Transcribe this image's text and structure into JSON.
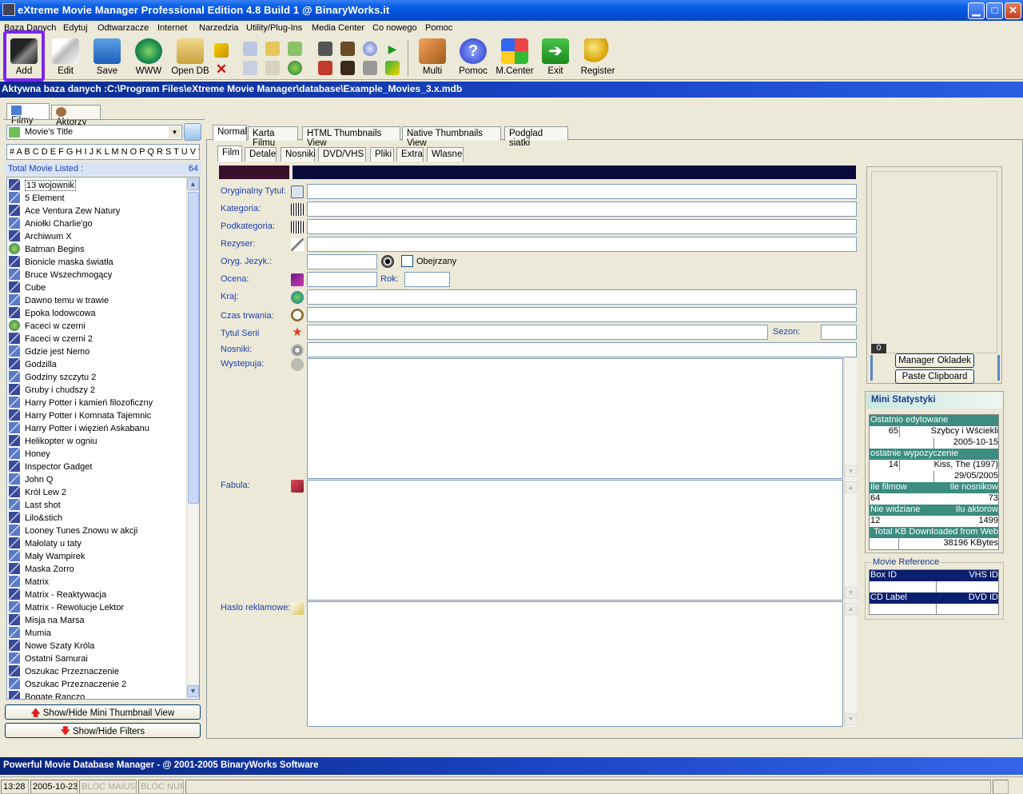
{
  "window": {
    "title": "eXtreme Movie Manager Professional Edition 4.8 Build 1 @ BinaryWorks.it",
    "min": "▁",
    "max": "□",
    "close": "✕"
  },
  "menu": [
    "Baza Danych",
    "Edytuj",
    "Odtwarzacze",
    "Internet",
    "Narzedzia",
    "Utility/Plug-Ins",
    "Media Center",
    "Co nowego",
    "Pomoc"
  ],
  "toolbar": {
    "add": "Add",
    "edit": "Edit",
    "save": "Save",
    "www": "WWW",
    "opendb": "Open DB",
    "multi": "Multi",
    "pomoc": "Pomoc",
    "mcenter": "M.Center",
    "exit": "Exit",
    "register": "Register"
  },
  "db_path": "Aktywna baza danych :C:\\Program Files\\eXtreme Movie Manager\\database\\Example_Movies_3.x.mdb",
  "left_tabs": {
    "filmy": "Filmy",
    "aktorzy": "Aktorzy"
  },
  "sort_field": "Movie's Title",
  "alphabet": "# A B C D E F G H I J K L M N O P Q R S T U V W X Y Z",
  "total_label": "Total Movie Listed :",
  "total_count": "64",
  "movies": [
    "13 wojownik",
    "5 Element",
    "Ace Ventura Zew Natury",
    "Aniołki Charlie'go",
    "Archiwum X",
    "Batman Begins",
    "Bionicle maska światła",
    "Bruce Wszechmogący",
    "Cube",
    "Dawno temu w trawie",
    "Epoka lodowcowa",
    "Faceci w czerni",
    "Faceci w czerni 2",
    "Gdzie jest Nemo",
    "Godzilla",
    "Godziny szczytu 2",
    "Gruby i chudszy 2",
    "Harry Potter i kamień filozoficzny",
    "Harry Potter i Komnata Tajemnic",
    "Harry Potter i więzień Askabanu",
    "Helikopter w ogniu",
    "Honey",
    "Inspector Gadget",
    "John Q",
    "Król Lew 2",
    "Last shot",
    "Lilo&stich",
    "Looney Tunes Znowu w akcji",
    "Małolaty u taty",
    "Mały Wampirek",
    "Maska Zorro",
    "Matrix",
    "Matrix - Reaktywacja",
    "Matrix - Rewolucje   Lektor",
    "Misja na Marsa",
    "Mumia",
    "Nowe Szaty Króla",
    "Ostatni Samurai",
    "Oszukac Przeznaczenie",
    "Oszukac Przeznaczenie 2",
    "Bogate Ranczo"
  ],
  "buttons": {
    "thumb": "Show/Hide Mini Thumbnail View",
    "filters": "Show/Hide Filters",
    "manager": "Manager Okladek",
    "paste": "Paste Clipboard"
  },
  "view_tabs": [
    "Normal",
    "Karta Filmu",
    "HTML Thumbnails View",
    "Native Thumbnails View",
    "Podglad siatki"
  ],
  "sub_tabs": [
    "Film",
    "Detale",
    "Nosniki",
    "DVD/VHS",
    "Pliki",
    "Extra",
    "Wlasne"
  ],
  "fields": {
    "orig_title": "Oryginalny Tytul:",
    "kategoria": "Kategoria:",
    "podkategoria": "Podkategoria:",
    "rezyser": "Rezyser:",
    "jezyk": "Oryg. Jezyk.:",
    "obejrzany": "Obejrzany",
    "ocena": "Ocena:",
    "rok": "Rok:",
    "kraj": "Kraj:",
    "czas": "Czas trwania:",
    "tytul_serii": "Tytul Serii",
    "sezon": "Sezon:",
    "nosniki": "Nosniki:",
    "wystepuja": "Wystepuja:",
    "fabula": "Fabula:",
    "haslo": "Haslo reklamowe:"
  },
  "cover_counter": "0",
  "mini_stats": {
    "title": "Mini Statystyki",
    "last_edited_label": "Ostatnio edytowane",
    "last_edited_id": "65",
    "last_edited_title": "Szybcy i Wściekli",
    "last_edited_date": "2005-10-15",
    "last_loan_label": "ostatnie wypozyczenie",
    "last_loan_id": "14",
    "last_loan_title": "Kiss, The (1997)",
    "last_loan_date": "29/05/2005",
    "ile_filmow_label": "Ile filmow",
    "ile_nosnikow_label": "Ile nosnikow",
    "ile_filmow": "64",
    "ile_nosnikow": "73",
    "nie_widziane_label": "Nie widziane",
    "ilu_aktorow_label": "Ilu aktorow",
    "nie_widziane": "12",
    "ilu_aktorow": "1499",
    "downloaded_label": "Total KB Downloaded from Web",
    "downloaded": "38196 KBytes"
  },
  "movie_reference": {
    "title": "Movie Reference",
    "box_id": "Box ID",
    "vhs_id": "VHS ID",
    "cd_label": "CD Label",
    "dvd_id": "DVD ID"
  },
  "status": "Powerful Movie Database Manager - @ 2001-2005 BinaryWorks Software",
  "bottom": {
    "time": "13:28",
    "date": "2005-10-23",
    "caps": "BLOC MAIUSC",
    "num": "BLOC NUM"
  },
  "colors": {
    "accent": "#0a46c2",
    "highlight": "#7b24f2",
    "stat_teal": "#3c8c80",
    "ref_navy": "#0a1f6e"
  }
}
